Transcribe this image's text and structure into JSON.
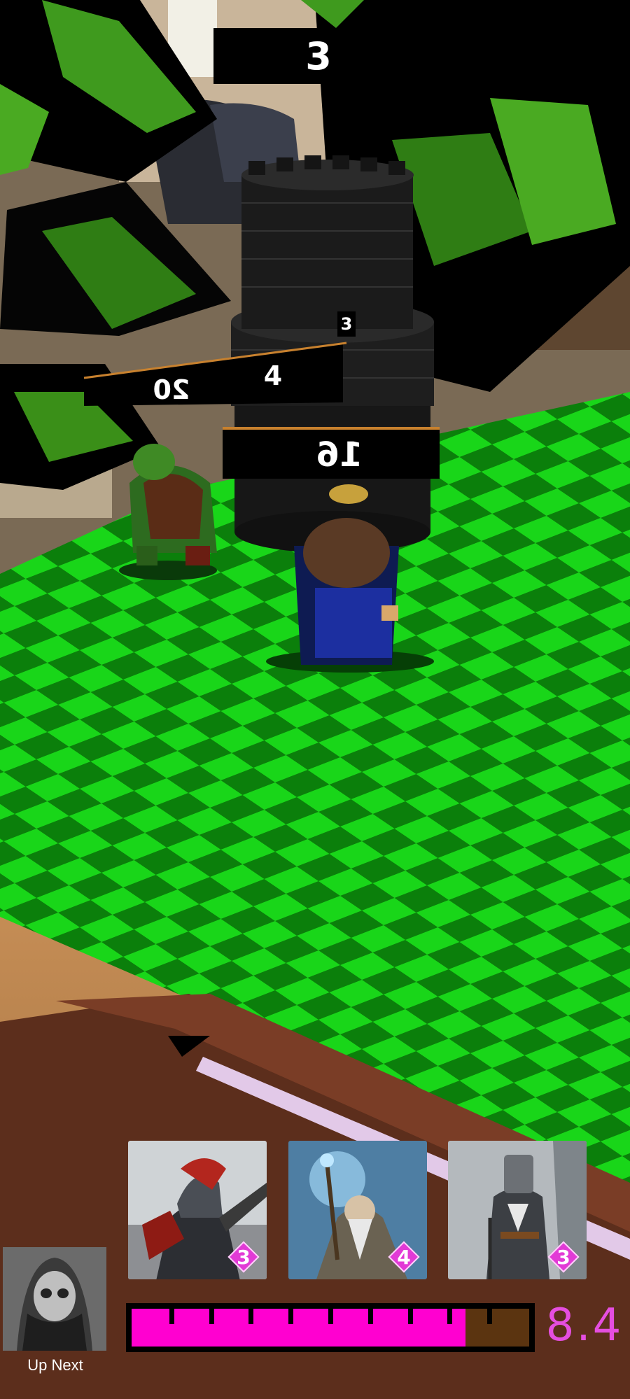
{
  "world_labels": {
    "top_number": "3",
    "tower_number_small": "3",
    "ogre_health": "20",
    "tower_level": "4",
    "tower_health": "16"
  },
  "hand": {
    "cards": [
      {
        "name": "Archer",
        "cost": "3"
      },
      {
        "name": "Wizard",
        "cost": "4"
      },
      {
        "name": "Knight",
        "cost": "3"
      }
    ]
  },
  "up_next": {
    "label": "Up Next",
    "name": "Rogue"
  },
  "mana": {
    "value": "8.4",
    "max": 10,
    "current": 8.4
  },
  "colors": {
    "board_light": "#19d619",
    "board_dark": "#0b7f0b",
    "mana_fill": "#ff00d0",
    "mana_text": "#e54ee0",
    "cost_gem": "#e23ad6"
  },
  "icons": {
    "cost": "diamond-gem-icon"
  }
}
